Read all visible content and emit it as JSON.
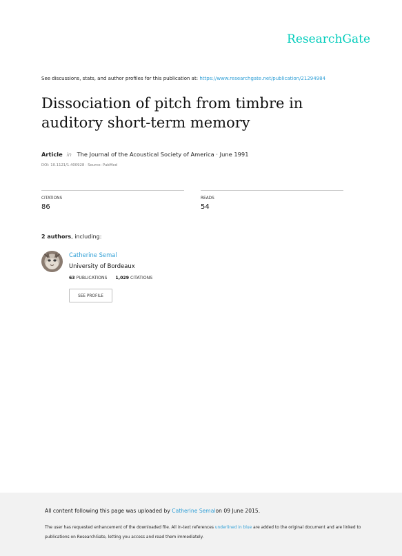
{
  "brand": {
    "name": "ResearchGate"
  },
  "header": {
    "discuss_text": "See discussions, stats, and author profiles for this publication at:",
    "discuss_url": "https://www.researchgate.net/publication/21294984"
  },
  "paper": {
    "title": "Dissociation of pitch from timbre in auditory short-term memory",
    "kind": "Article",
    "in_label": "in",
    "venue": "The Journal of the Acoustical Society of America · June 1991",
    "doi": "DOI: 10.1121/1.400928 · Source: PubMed"
  },
  "stats": {
    "citations_label": "CITATIONS",
    "citations_value": "86",
    "reads_label": "READS",
    "reads_value": "54"
  },
  "authors": {
    "count_text": "2 authors",
    "suffix": ", including:",
    "items": [
      {
        "name": "Catherine Semal",
        "affiliation": "University of Bordeaux",
        "publications_count": "63",
        "publications_label": "PUBLICATIONS",
        "citations_count": "1,029",
        "citations_label": "CITATIONS",
        "button_label": "SEE PROFILE"
      }
    ]
  },
  "footer": {
    "line1_pre": "All content following this page was uploaded by",
    "line1_author": "Catherine Semal",
    "line1_post": "on 09 June 2015.",
    "line2_pre": "The user has requested enhancement of the downloaded file. All in-text references",
    "line2_link": "underlined in blue",
    "line2_post": "are added to the original document and are linked to publications on ResearchGate, letting you access and read them immediately."
  },
  "colors": {
    "brand": "#00ccbb",
    "link": "#2f9fd6",
    "footer_bg": "#f2f2f2"
  }
}
